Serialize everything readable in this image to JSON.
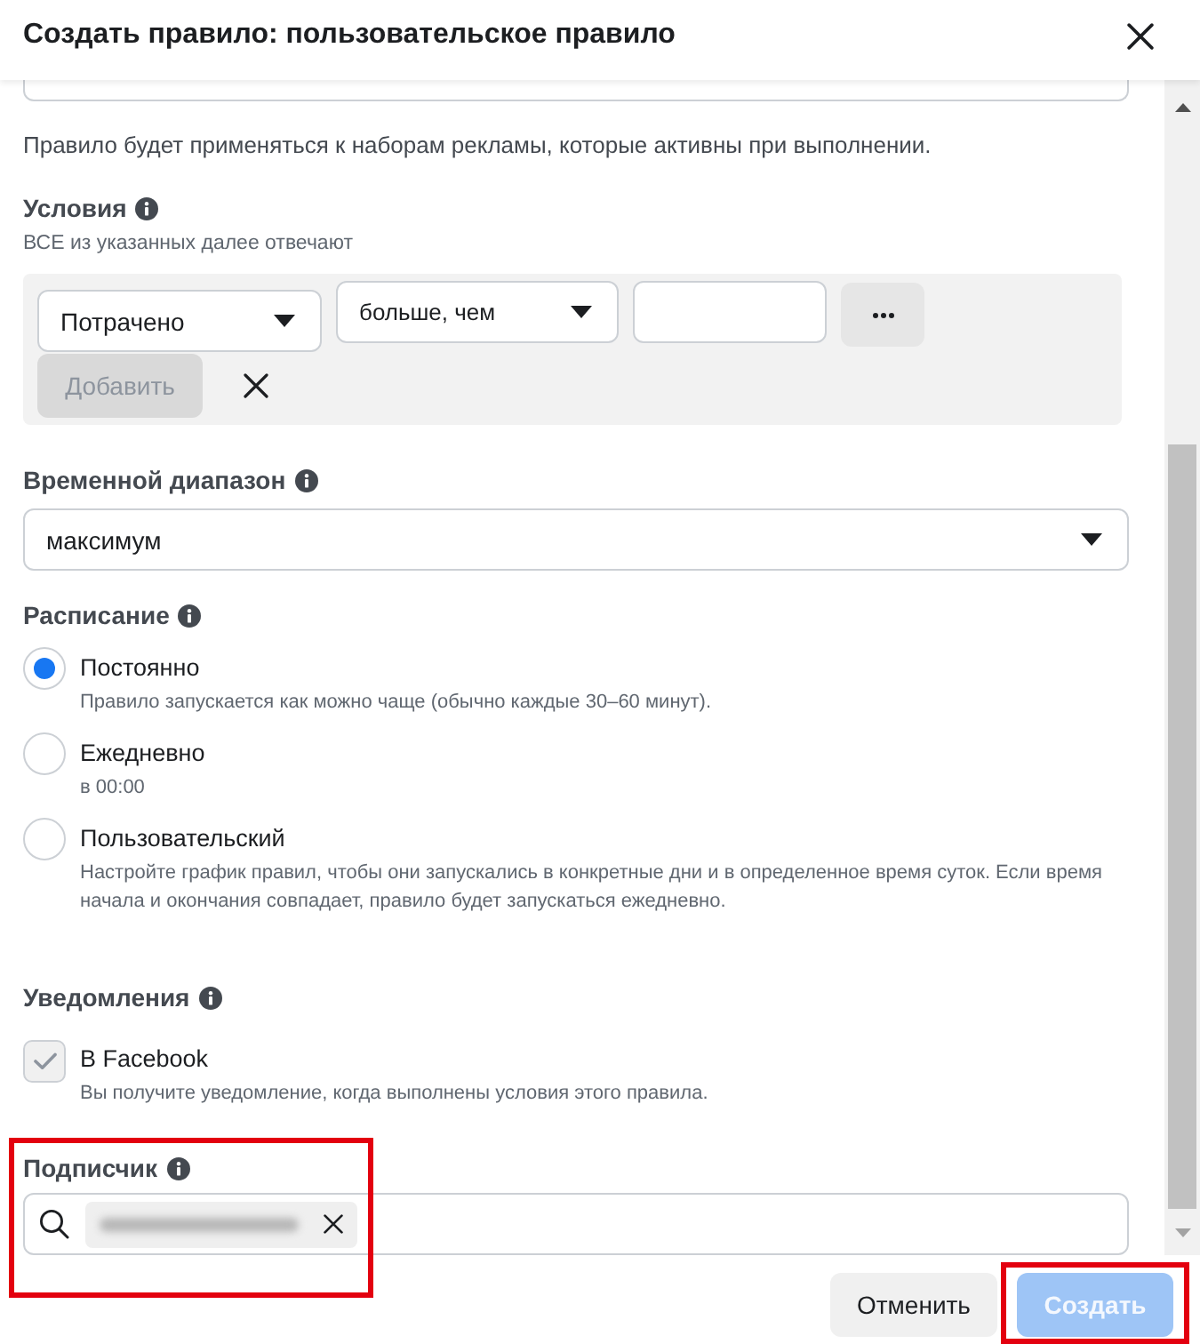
{
  "dialog": {
    "title": "Создать правило: пользовательское правило"
  },
  "scope_note": "Правило будет применяться к наборам рекламы, которые активны при выполнении.",
  "conditions": {
    "label": "Условия",
    "hint": "ВСЕ из указанных далее отвечают",
    "metric": "Потрачено",
    "operator": "больше, чем",
    "add_button": {
      "label": "Добавить",
      "disabled": true
    }
  },
  "time_range": {
    "label": "Временной диапазон",
    "value": "максимум"
  },
  "schedule": {
    "label": "Расписание",
    "options": [
      {
        "label": "Постоянно",
        "description": "Правило запускается как можно чаще (обычно каждые 30–60 минут).",
        "selected": true
      },
      {
        "label": "Ежедневно",
        "description": "в 00:00",
        "selected": false
      },
      {
        "label": "Пользовательский",
        "description": "Настройте график правил, чтобы они запускались в конкретные дни и в определенное время суток. Если время начала и окончания совпадает, правило будет запускаться ежедневно.",
        "selected": false
      }
    ]
  },
  "notifications": {
    "label": "Уведомления",
    "options": [
      {
        "label": "В Facebook",
        "description": "Вы получите уведомление, когда выполнены условия этого правила.",
        "checked": true,
        "disabled": true
      }
    ]
  },
  "subscriber": {
    "label": "Подписчик",
    "recipient_selected": true,
    "highlighted": true
  },
  "buttons": [
    {
      "label": "Отменить",
      "kind": "secondary",
      "disabled": false,
      "highlighted": false
    },
    {
      "label": "Создать",
      "kind": "primary",
      "disabled": true,
      "highlighted": true
    }
  ]
}
